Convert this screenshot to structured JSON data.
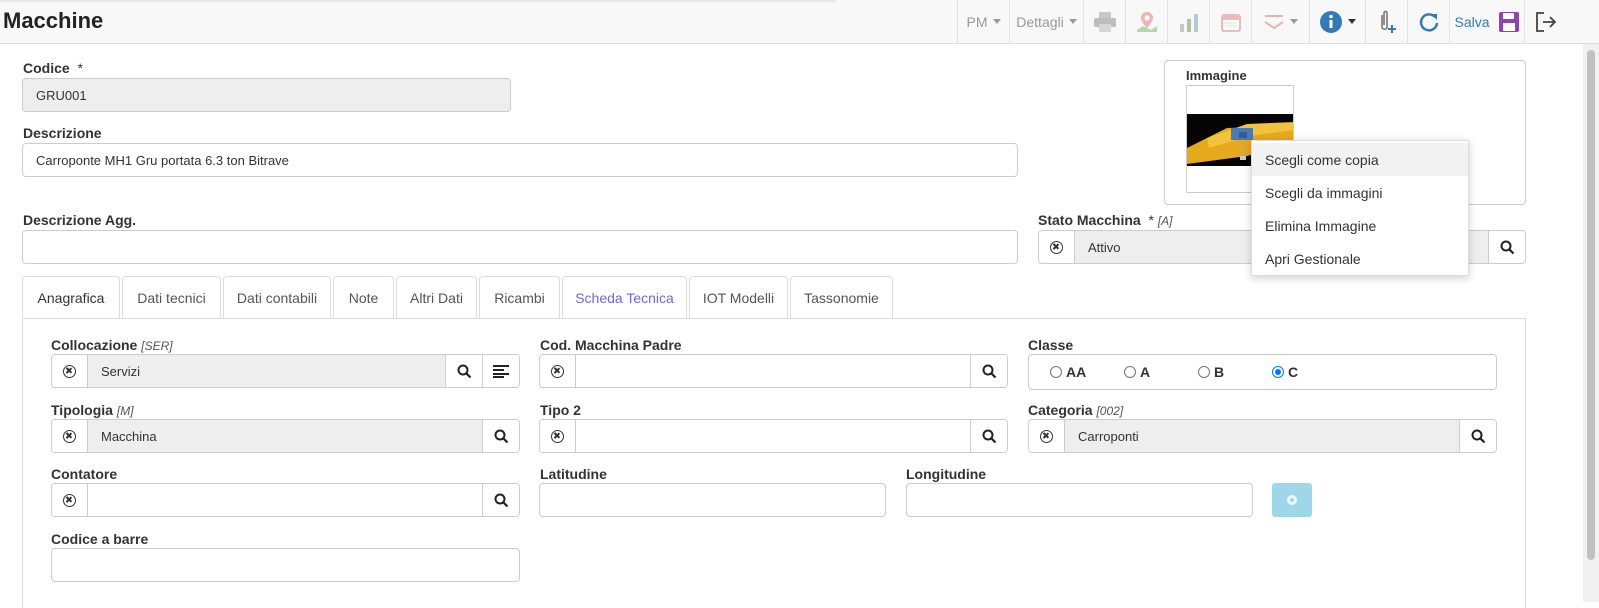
{
  "header": {
    "title": "Macchine",
    "pm_label": "PM",
    "details_label": "Dettagli",
    "save_label": "Salva"
  },
  "form": {
    "codice": {
      "label": "Codice",
      "required": "*",
      "value": "GRU001"
    },
    "descrizione": {
      "label": "Descrizione",
      "value": "Carroponte MH1 Gru portata 6.3 ton Bitrave"
    },
    "descrizione_agg": {
      "label": "Descrizione Agg.",
      "value": ""
    },
    "stato_macchina": {
      "label": "Stato Macchina",
      "required": "*",
      "code": "[A]",
      "value": "Attivo"
    },
    "immagine": {
      "label": "Immagine"
    }
  },
  "image_menu": {
    "items": [
      "Scegli come copia",
      "Scegli da immagini",
      "Elimina Immagine",
      "Apri Gestionale"
    ]
  },
  "tabs": [
    {
      "label": "Anagrafica",
      "active": true
    },
    {
      "label": "Dati tecnici"
    },
    {
      "label": "Dati contabili"
    },
    {
      "label": "Note"
    },
    {
      "label": "Altri Dati"
    },
    {
      "label": "Ricambi"
    },
    {
      "label": "Scheda Tecnica"
    },
    {
      "label": "IOT Modelli"
    },
    {
      "label": "Tassonomie"
    }
  ],
  "anagrafica": {
    "collocazione": {
      "label": "Collocazione",
      "code": "[SER]",
      "value": "Servizi"
    },
    "cod_macchina_padre": {
      "label": "Cod. Macchina Padre",
      "value": ""
    },
    "classe": {
      "label": "Classe",
      "options": [
        "AA",
        "A",
        "B",
        "C"
      ],
      "selected": "C"
    },
    "tipologia": {
      "label": "Tipologia",
      "code": "[M]",
      "value": "Macchina"
    },
    "tipo2": {
      "label": "Tipo 2",
      "value": ""
    },
    "categoria": {
      "label": "Categoria",
      "code": "[002]",
      "value": "Carroponti"
    },
    "contatore": {
      "label": "Contatore",
      "value": ""
    },
    "latitudine": {
      "label": "Latitudine",
      "value": ""
    },
    "longitudine": {
      "label": "Longitudine",
      "value": ""
    },
    "codice_barre": {
      "label": "Codice a barre",
      "value": ""
    }
  },
  "colors": {
    "accent": "#337ab7",
    "readonly_bg": "#eeeeee",
    "geo_button": "#9fd6ea",
    "tab_highlight": "#6b6bd6"
  }
}
